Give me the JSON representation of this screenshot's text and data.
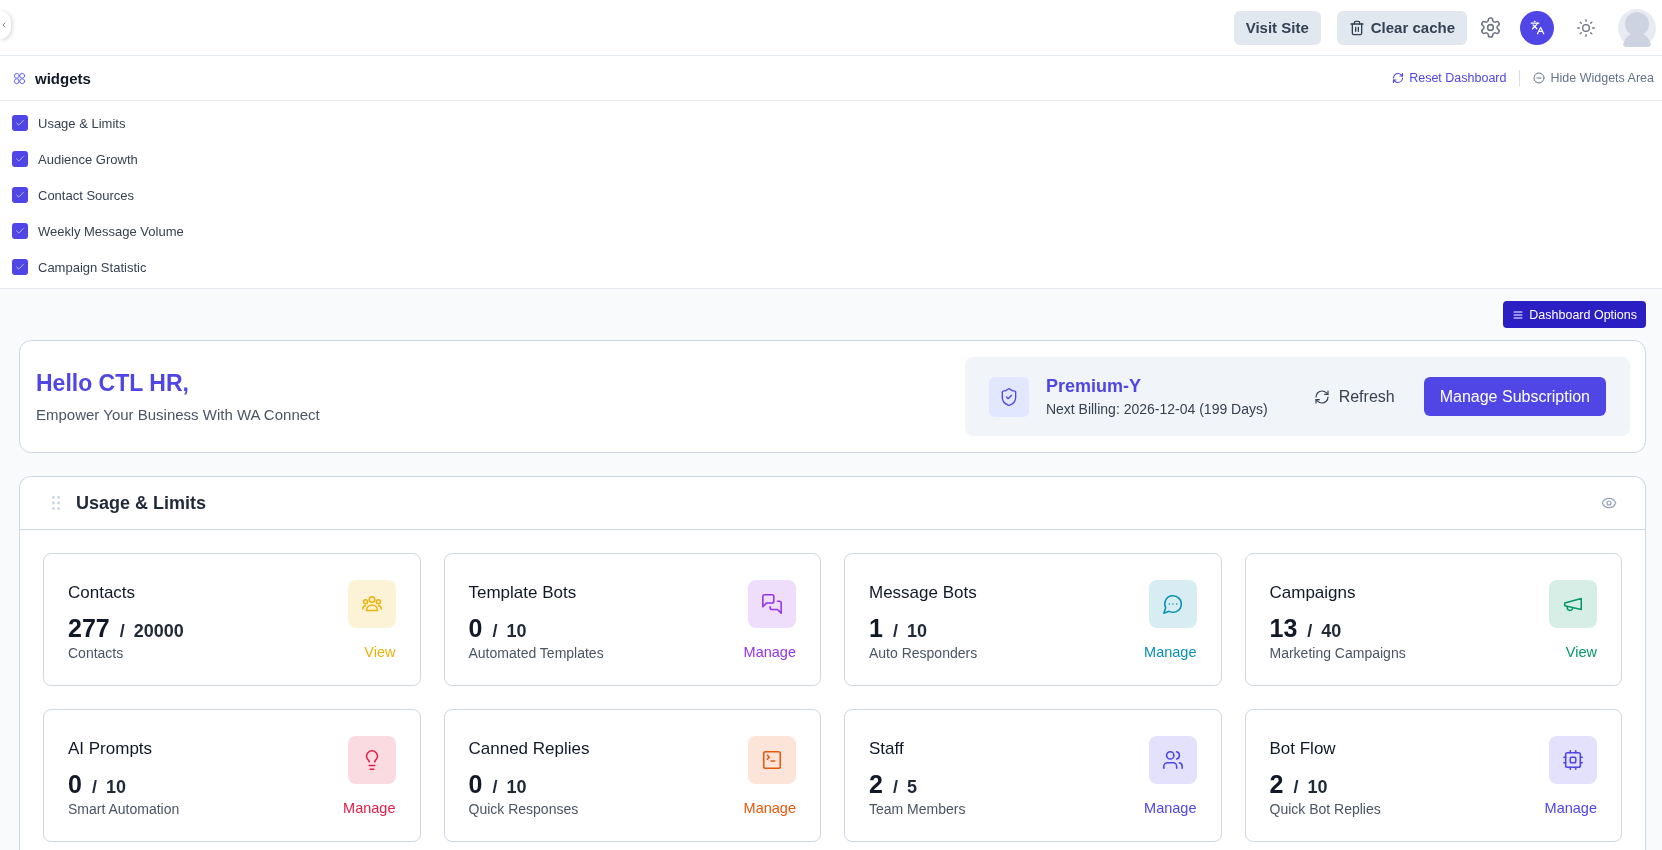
{
  "top_bar": {
    "visit_site": "Visit Site",
    "clear_cache": "Clear cache"
  },
  "widgets_bar": {
    "title": "widgets",
    "reset": "Reset Dashboard",
    "hide": "Hide Widgets Area"
  },
  "widgets": [
    {
      "label": "Usage & Limits",
      "checked": true
    },
    {
      "label": "Audience Growth",
      "checked": true
    },
    {
      "label": "Contact Sources",
      "checked": true
    },
    {
      "label": "Weekly Message Volume",
      "checked": true
    },
    {
      "label": "Campaign Statistic",
      "checked": true
    }
  ],
  "dashboard_options": "Dashboard Options",
  "welcome": {
    "greeting": "Hello CTL HR,",
    "tagline": "Empower Your Business With WA Connect"
  },
  "subscription": {
    "plan": "Premium-Y",
    "next_billing": "Next Billing: 2026-12-04 (199 Days)",
    "refresh": "Refresh",
    "manage": "Manage Subscription"
  },
  "usage_panel": {
    "title": "Usage & Limits",
    "cards": [
      {
        "title": "Contacts",
        "count": "277",
        "limit": "/ 20000",
        "subtitle": "Contacts",
        "action": "View",
        "color": "#eab308"
      },
      {
        "title": "Template Bots",
        "count": "0",
        "limit": "/ 10",
        "subtitle": "Automated Templates",
        "action": "Manage",
        "color": "#9333ea"
      },
      {
        "title": "Message Bots",
        "count": "1",
        "limit": "/ 10",
        "subtitle": "Auto Responders",
        "action": "Manage",
        "color": "#0891b2"
      },
      {
        "title": "Campaigns",
        "count": "13",
        "limit": "/ 40",
        "subtitle": "Marketing Campaigns",
        "action": "View",
        "color": "#059669"
      },
      {
        "title": "AI Prompts",
        "count": "0",
        "limit": "/ 10",
        "subtitle": "Smart Automation",
        "action": "Manage",
        "color": "#e11d48"
      },
      {
        "title": "Canned Replies",
        "count": "0",
        "limit": "/ 10",
        "subtitle": "Quick Responses",
        "action": "Manage",
        "color": "#ea580c"
      },
      {
        "title": "Staff",
        "count": "2",
        "limit": "/ 5",
        "subtitle": "Team Members",
        "action": "Manage",
        "color": "#4f46e5"
      },
      {
        "title": "Bot Flow",
        "count": "2",
        "limit": "/ 10",
        "subtitle": "Quick Bot Replies",
        "action": "Manage",
        "color": "#4f46e5"
      }
    ]
  }
}
